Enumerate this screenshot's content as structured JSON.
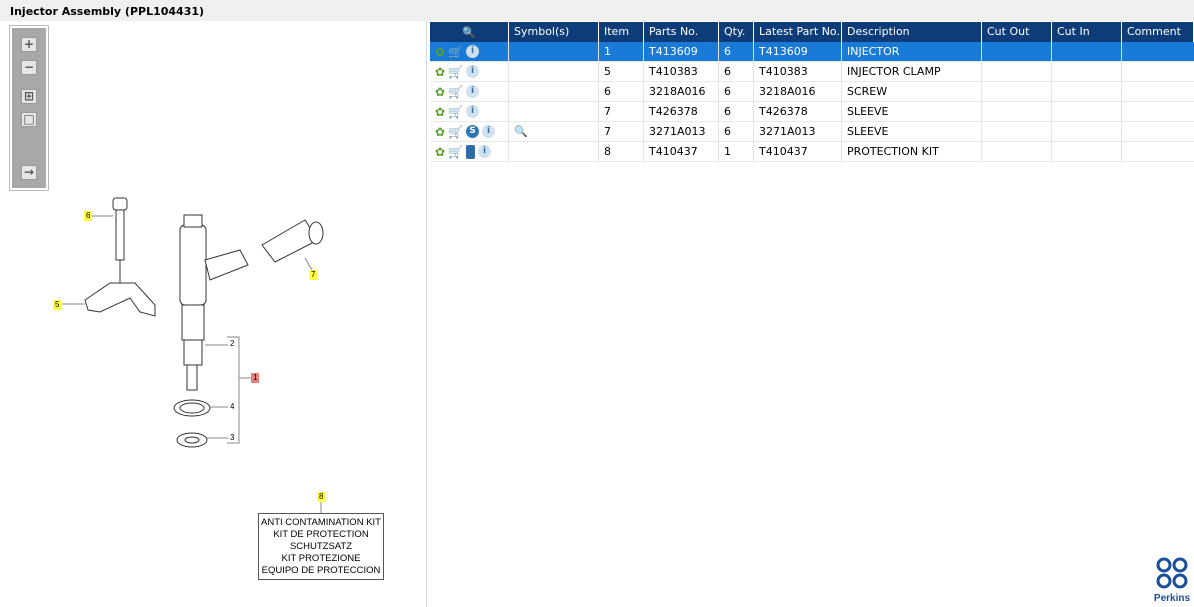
{
  "title": "Injector Assembly (PPL104431)",
  "toolbar": {
    "zoom_in": "+",
    "zoom_out": "−",
    "fit": "⊞",
    "actual": "□",
    "export": "→"
  },
  "diagram": {
    "callouts": [
      "6",
      "5",
      "7",
      "1",
      "2",
      "4",
      "3",
      "8"
    ],
    "kit_label": [
      "ANTI CONTAMINATION KIT",
      "KIT DE PROTECTION",
      "SCHUTZSATZ",
      "KIT PROTEZIONE",
      "EQUIPO DE PROTECCION"
    ]
  },
  "table": {
    "headers": [
      "Symbol(s)",
      "Item",
      "Parts No.",
      "Qty.",
      "Latest Part No.",
      "Description",
      "Cut Out",
      "Cut In",
      "Comment"
    ],
    "rows": [
      {
        "item": "1",
        "part": "T413609",
        "qty": "6",
        "latest": "T413609",
        "desc": "INJECTOR",
        "selected": true
      },
      {
        "item": "5",
        "part": "T410383",
        "qty": "6",
        "latest": "T410383",
        "desc": "INJECTOR CLAMP"
      },
      {
        "item": "6",
        "part": "3218A016",
        "qty": "6",
        "latest": "3218A016",
        "desc": "SCREW"
      },
      {
        "item": "7",
        "part": "T426378",
        "qty": "6",
        "latest": "T426378",
        "desc": "SLEEVE"
      },
      {
        "item": "7",
        "part": "3271A013",
        "qty": "6",
        "latest": "3271A013",
        "desc": "SLEEVE"
      },
      {
        "item": "8",
        "part": "T410437",
        "qty": "1",
        "latest": "T410437",
        "desc": "PROTECTION KIT"
      }
    ]
  },
  "logo": "Perkins"
}
